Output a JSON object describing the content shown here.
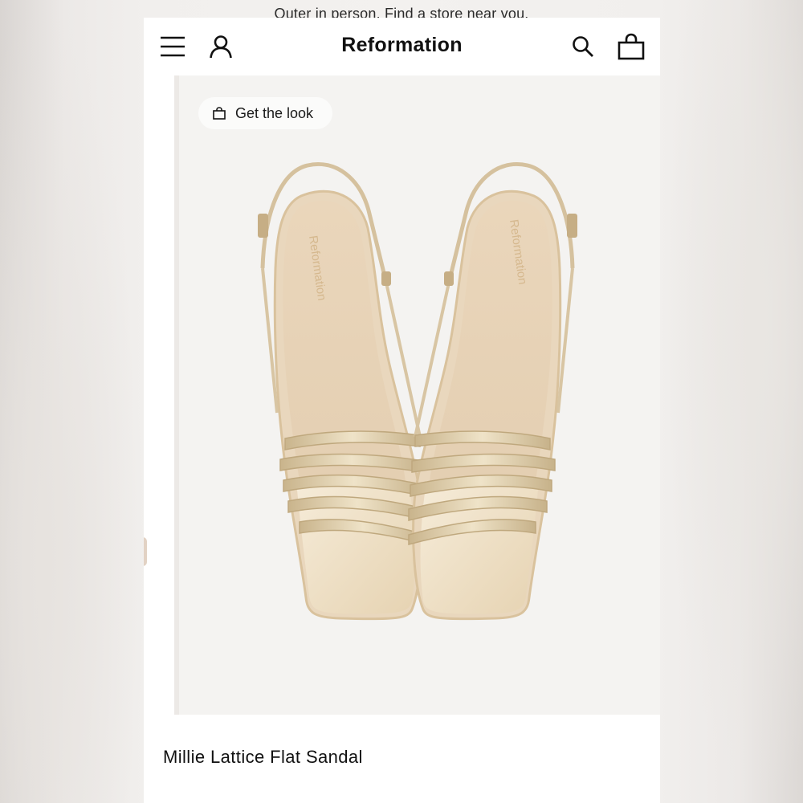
{
  "promo": {
    "prefix": "Outer in person. Find a ",
    "link": "store",
    "suffix": " near you."
  },
  "header": {
    "brand": "Reformation",
    "icons": [
      "menu-icon",
      "account-icon",
      "search-icon",
      "bag-icon"
    ]
  },
  "gallery": {
    "get_the_look_label": "Get the look",
    "image_icon": "sandal-photo",
    "insole_brand": "Reformation"
  },
  "product": {
    "name": "Millie Lattice Flat Sandal"
  },
  "colors": {
    "accent_text": "#111111",
    "panel": "#f4f3f1",
    "metallic_gold": "#d9c6a3"
  }
}
